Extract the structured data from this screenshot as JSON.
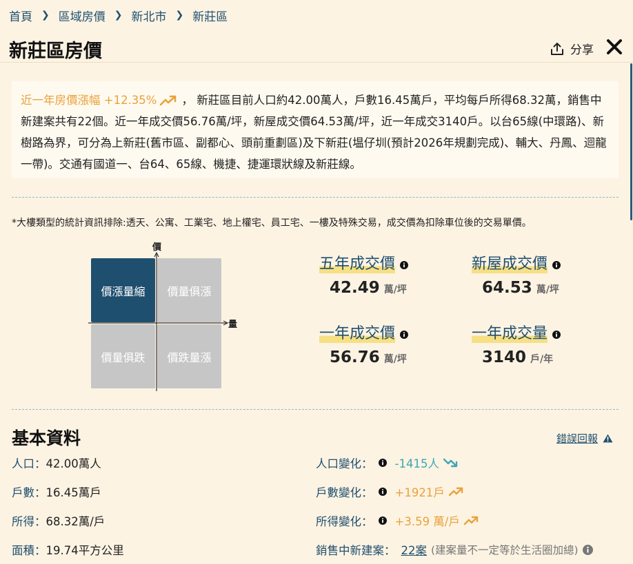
{
  "breadcrumb": [
    "首頁",
    "區域房價",
    "新北市",
    "新莊區"
  ],
  "page_title": "新莊區房價",
  "share_label": "分享",
  "summary": {
    "highlight": "近一年房價漲幅 +12.35%",
    "text": "， 新莊區目前人口約42.00萬人，戶數16.45萬戶，平均每戶所得68.32萬，銷售中新建案共有22個。近一年成交價56.76萬/坪，新屋成交價64.53萬/坪，近一年成交3140戶。以台65線(中環路)、新樹路為界，可分為上新莊(舊市區、副都心、頭前重劃區)及下新莊(塭仔圳(預計2026年規劃完成)、輔大、丹鳳、迴龍一帶)。交通有國道一、台64、65線、機捷、捷運環狀線及新莊線。"
  },
  "note": "*大樓類型的統計資訊排除:透天、公寓、工業宅、地上權宅、員工宅、一樓及特殊交易，成交價為扣除車位後的交易單價。",
  "quadrant": {
    "axis_y": "價",
    "axis_x": "量",
    "cells": [
      "價漲量縮",
      "價量俱漲",
      "價量俱跌",
      "價跌量漲"
    ],
    "active": "價漲量縮"
  },
  "stats": [
    {
      "label": "五年成交價",
      "value": "42.49",
      "unit": "萬/坪"
    },
    {
      "label": "新屋成交價",
      "value": "64.53",
      "unit": "萬/坪"
    },
    {
      "label": "一年成交價",
      "value": "56.76",
      "unit": "萬/坪"
    },
    {
      "label": "一年成交量",
      "value": "3140",
      "unit": "戶/年"
    }
  ],
  "basic": {
    "title": "基本資料",
    "report_label": "錯誤回報",
    "items": [
      {
        "key": "人口：",
        "value": "42.00萬人"
      },
      {
        "key": "戶數：",
        "value": "16.45萬戶"
      },
      {
        "key": "所得：",
        "value": "68.32萬/戶"
      },
      {
        "key": "面積：",
        "value": "19.74平方公里"
      }
    ],
    "changes": [
      {
        "key": "人口變化：",
        "value": "-1415人",
        "dir": "down"
      },
      {
        "key": "戶數變化：",
        "value": "+1921戶",
        "dir": "up"
      },
      {
        "key": "所得變化：",
        "value": "+3.59 萬/戶",
        "dir": "up"
      }
    ],
    "sale": {
      "key": "銷售中新建案：",
      "link": "22案",
      "note": "(建案量不一定等於生活圈加總)"
    }
  },
  "colors": {
    "accent": "#1f4f6e",
    "up": "#e8a23b",
    "down": "#3aa7b4",
    "background": "#fdf3e3",
    "highlight": "#f7df84"
  },
  "icons": [
    "chevron-right-icon",
    "share-icon",
    "close-icon",
    "trend-up-icon",
    "trend-down-icon",
    "info-icon",
    "warning-icon"
  ]
}
